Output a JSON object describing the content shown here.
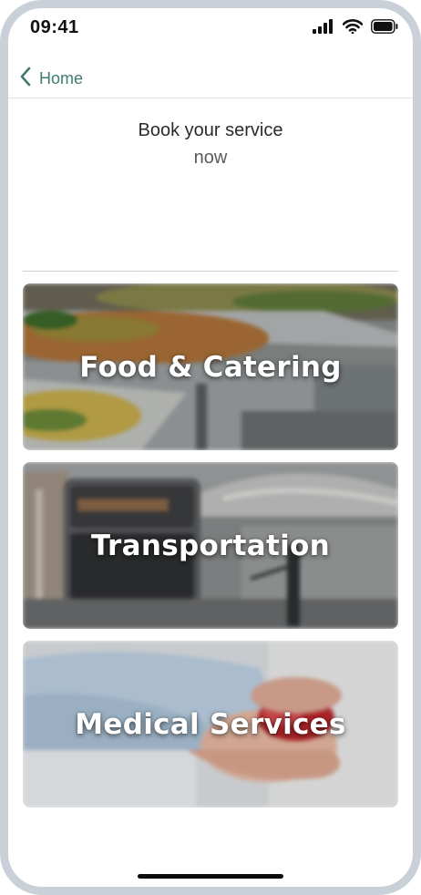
{
  "status_bar": {
    "time": "09:41",
    "icons": [
      "cellular-signal-icon",
      "wifi-icon",
      "battery-icon"
    ]
  },
  "nav": {
    "back_label": "Home",
    "back_icon": "chevron-left-icon",
    "accent_color": "#3f7b72"
  },
  "heading": {
    "line1": "Book your service",
    "line2": "now"
  },
  "services": [
    {
      "label": "Food & Catering"
    },
    {
      "label": "Transportation"
    },
    {
      "label": "Medical Services"
    }
  ]
}
